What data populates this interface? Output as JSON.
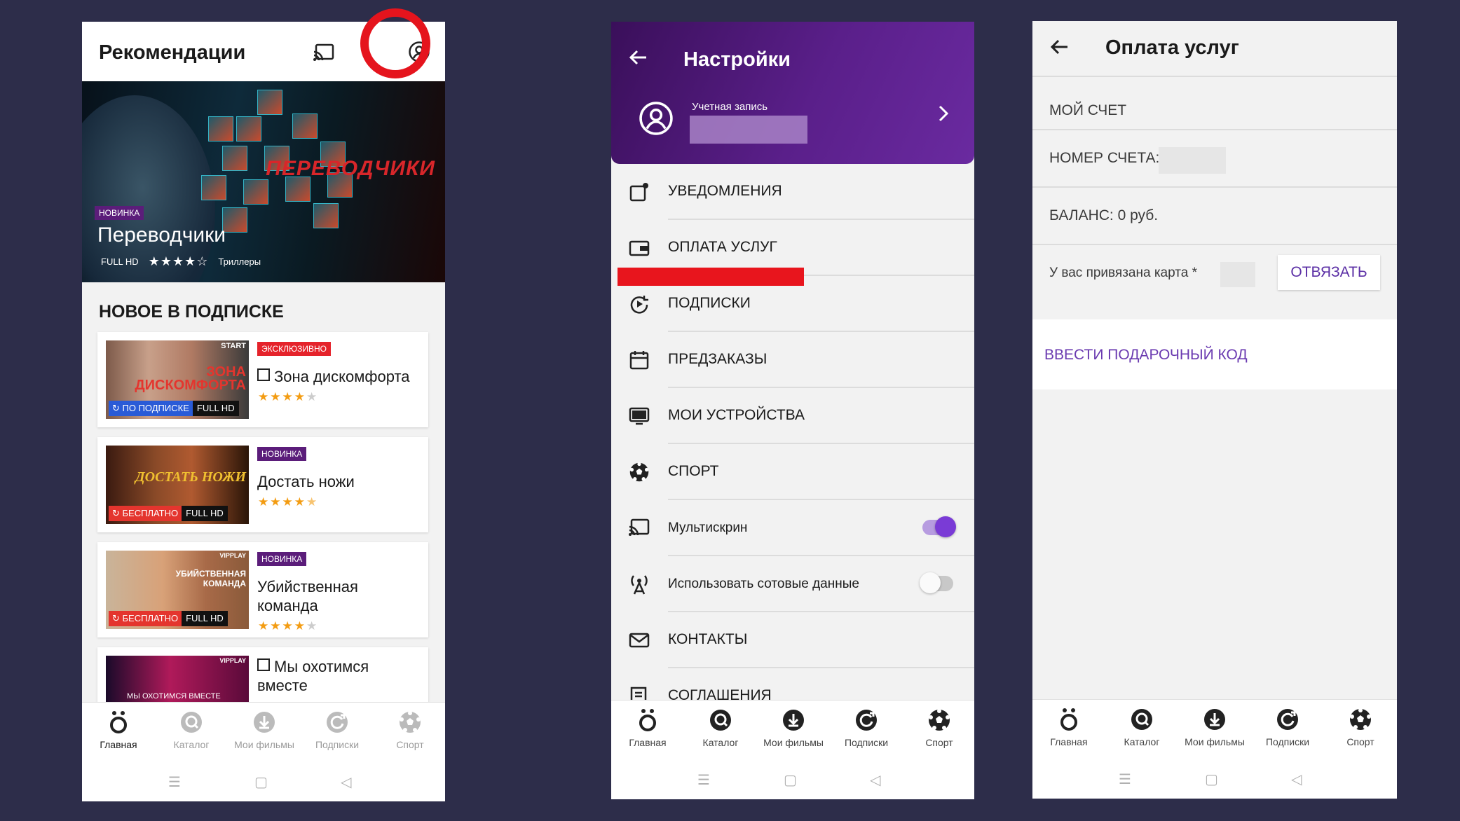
{
  "screen1": {
    "title": "Рекомендации",
    "hero": {
      "poster_title": "ПЕРЕВОДЧИКИ",
      "tag": "НОВИНКА",
      "name": "Переводчики",
      "quality": "FULL HD",
      "rating": "★★★★☆",
      "genre": "Триллеры"
    },
    "section_title": "НОВОЕ В ПОДПИСКЕ",
    "cards": [
      {
        "tag": "ЭКСКЛЮЗИВНО",
        "title": "Зона дискомфорта",
        "rating": 4,
        "access": "ПО ПОДПИСКЕ",
        "quality": "FULL HD",
        "poster_text": "ЗОНА ДИСКОМФОРТА",
        "poster_logo": "START"
      },
      {
        "tag": "НОВИНКА",
        "title": "Достать ножи",
        "rating": 4.5,
        "access": "БЕСПЛАТНО",
        "quality": "FULL HD",
        "poster_text": "ДОСТАТЬ НОЖИ"
      },
      {
        "tag": "НОВИНКА",
        "title": "Убийственная команда",
        "rating": 4,
        "access": "БЕСПЛАТНО",
        "quality": "FULL HD",
        "poster_text": "УБИЙСТВЕННАЯ КОМАНДА",
        "poster_logo": "VIPPLAY"
      },
      {
        "tag": "",
        "title": "Мы охотимся вместе",
        "poster_text": "МЫ ОХОТИМСЯ ВМЕСТЕ",
        "poster_logo": "VIPPLAY"
      }
    ]
  },
  "nav": {
    "items": [
      {
        "label": "Главная",
        "icon": "home-logo-icon"
      },
      {
        "label": "Каталог",
        "icon": "catalog-icon"
      },
      {
        "label": "Мои фильмы",
        "icon": "download-icon"
      },
      {
        "label": "Подписки",
        "icon": "subscriptions-icon"
      },
      {
        "label": "Спорт",
        "icon": "soccer-ball-icon"
      }
    ]
  },
  "screen2": {
    "title": "Настройки",
    "account_label": "Учетная запись",
    "items": [
      {
        "label": "УВЕДОМЛЕНИЯ",
        "icon": "notifications-icon"
      },
      {
        "label": "ОПЛАТА УСЛУГ",
        "icon": "wallet-icon"
      },
      {
        "label": "ПОДПИСКИ",
        "icon": "subscriptions-icon"
      },
      {
        "label": "ПРЕДЗАКАЗЫ",
        "icon": "calendar-icon"
      },
      {
        "label": "МОИ УСТРОЙСТВА",
        "icon": "devices-icon"
      },
      {
        "label": "СПОРТ",
        "icon": "soccer-ball-icon"
      },
      {
        "label": "Мультискрин",
        "icon": "cast-icon",
        "toggle": true
      },
      {
        "label": "Использовать сотовые данные",
        "icon": "antenna-icon",
        "toggle": false
      },
      {
        "label": "КОНТАКТЫ",
        "icon": "mail-icon"
      },
      {
        "label": "СОГЛАШЕНИЯ",
        "icon": "document-icon"
      }
    ]
  },
  "screen3": {
    "title": "Оплата услуг",
    "my_account": "МОЙ СЧЕТ",
    "account_number_label": "НОМЕР СЧЕТА:",
    "balance": "БАЛАНС: 0 руб.",
    "card_bound": "У вас привязана карта *",
    "unbind_label": "ОТВЯЗАТЬ",
    "gift_code": "ВВЕСТИ ПОДАРОЧНЫЙ КОД"
  },
  "colors": {
    "accent": "#6a2aa0",
    "highlight": "#e5141d",
    "star": "#f39c12"
  }
}
